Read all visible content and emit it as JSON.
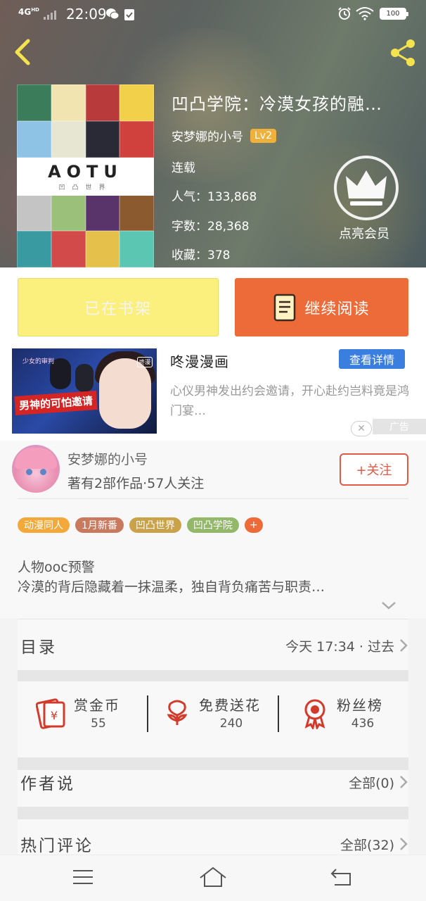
{
  "status_bar": {
    "network": "4G",
    "network_hd": "HD",
    "time": "22:09",
    "battery": "100"
  },
  "book": {
    "title": "凹凸学院：冷漠女孩的融…",
    "author": "安梦娜的小号",
    "level": "Lv2",
    "status": "连载",
    "popularity": "人气：133,868",
    "word_count": "字数：28,368",
    "collections": "收藏：378",
    "cover_logo": "AOTU",
    "cover_logo_sub": "凹凸世界"
  },
  "vip": {
    "label": "点亮会员"
  },
  "actions": {
    "shelf_label": "已在书架",
    "read_label": "继续阅读"
  },
  "ad": {
    "title": "咚漫漫画",
    "detail_label": "查看详情",
    "description": "心仪男神发出约会邀请，开心赴约岂料竟是鸿门宴…",
    "image_banner": "男神的可怕邀请",
    "image_tag": "少女的审判",
    "image_logo": "咚漫",
    "close_label": "✕",
    "ad_mark": "广告"
  },
  "author_card": {
    "name": "安梦娜的小号",
    "stats": "著有2部作品·57人关注",
    "follow_label": "+关注"
  },
  "tags": [
    {
      "label": "动漫同人",
      "color": "#f3a93a"
    },
    {
      "label": "1月新番",
      "color": "#c97a5e"
    },
    {
      "label": "凹凸世界",
      "color": "#c9a24a"
    },
    {
      "label": "凹凸学院",
      "color": "#93b86a"
    },
    {
      "label": "+",
      "color": "#ec6b38"
    }
  ],
  "description": {
    "line1": "人物ooc预警",
    "line2": "冷漠的背后隐藏着一抹温柔，独自背负痛苦与职责…"
  },
  "catalog": {
    "title": "目录",
    "update": "今天 17:34 · 过去"
  },
  "rewards": [
    {
      "label": "赏金币",
      "count": "55",
      "icon": "coin-envelope-icon"
    },
    {
      "label": "免费送花",
      "count": "240",
      "icon": "flower-icon"
    },
    {
      "label": "粉丝榜",
      "count": "436",
      "icon": "ribbon-medal-icon"
    }
  ],
  "author_says": {
    "title": "作者说",
    "count": "全部(0)"
  },
  "hot_comments": {
    "title": "热门评论",
    "count": "全部(32)"
  },
  "colors": {
    "accent_orange": "#ec6b38",
    "shelf_yellow": "#fbef7d",
    "follow_red": "#e05a45",
    "ad_blue": "#3a7fe0"
  }
}
